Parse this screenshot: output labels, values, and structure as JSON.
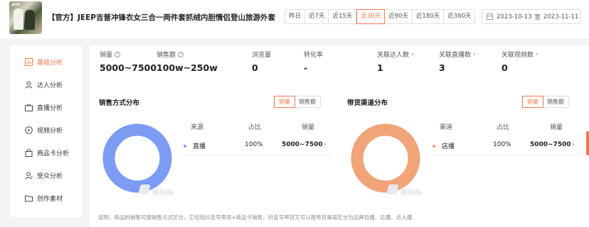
{
  "product": {
    "thumbnail_logo": "JEEP",
    "title": "【官方】JEEP吉普冲锋衣女三合一两件套抓绒内胆情侣登山旅游外套"
  },
  "date_ranges": [
    {
      "label": "昨日",
      "active": false
    },
    {
      "label": "近7天",
      "active": false
    },
    {
      "label": "近15天",
      "active": false
    },
    {
      "label": "近30天",
      "active": true
    },
    {
      "label": "近90天",
      "active": false
    },
    {
      "label": "近180天",
      "active": false
    },
    {
      "label": "近360天",
      "active": false
    }
  ],
  "date_picker": {
    "start": "2023-10-13",
    "separator": "至",
    "end": "2023-11-11"
  },
  "sidebar": {
    "items": [
      {
        "label": "基础分析",
        "icon": "chart-doc-icon",
        "active": true
      },
      {
        "label": "达人分析",
        "icon": "user-icon",
        "active": false
      },
      {
        "label": "直播分析",
        "icon": "tv-icon",
        "active": false
      },
      {
        "label": "视频分析",
        "icon": "play-circle-icon",
        "active": false
      },
      {
        "label": "商品卡分析",
        "icon": "shopping-bag-icon",
        "active": false
      },
      {
        "label": "受众分析",
        "icon": "audience-icon",
        "active": false
      },
      {
        "label": "创作素材",
        "icon": "folder-icon",
        "active": false
      }
    ]
  },
  "stats": [
    {
      "label": "销量",
      "value": "5000~7500",
      "help": true,
      "link": false
    },
    {
      "label": "销售额",
      "value": "100w~250w",
      "help": true,
      "link": false
    },
    {
      "label": "浏览量",
      "value": "0",
      "help": false,
      "link": false
    },
    {
      "label": "转化率",
      "value": "-",
      "help": false,
      "link": false
    },
    {
      "label": "关联达人数",
      "value": "1",
      "help": false,
      "link": true
    },
    {
      "label": "关联直播数",
      "value": "3",
      "help": false,
      "link": true
    },
    {
      "label": "关联视频数",
      "value": "0",
      "help": false,
      "link": true
    }
  ],
  "sales_method": {
    "title": "销售方式分布",
    "toggle": [
      "销量",
      "销售额"
    ],
    "columns": [
      "来源",
      "占比",
      "销量"
    ],
    "rows": [
      {
        "name": "直播",
        "share": "100%",
        "sales": "5000~7500"
      }
    ],
    "ring_color": "#7b9cf2"
  },
  "sales_channel": {
    "title": "带货渠道分布",
    "toggle": [
      "销量",
      "销售额"
    ],
    "columns": [
      "渠道",
      "占比",
      "销量"
    ],
    "rows": [
      {
        "name": "店播",
        "share": "100%",
        "sales": "5000~7500"
      }
    ],
    "ring_color": "#f0a478"
  },
  "watermark": "蝉妈妈",
  "note": "说明：商品的销售可按销售方式区分，它包括抖音号带货+商品卡销售。抖音号带货又可以按带货渠道区分为品牌自播、店播、达人播",
  "colors": {
    "accent": "#f5774b"
  }
}
